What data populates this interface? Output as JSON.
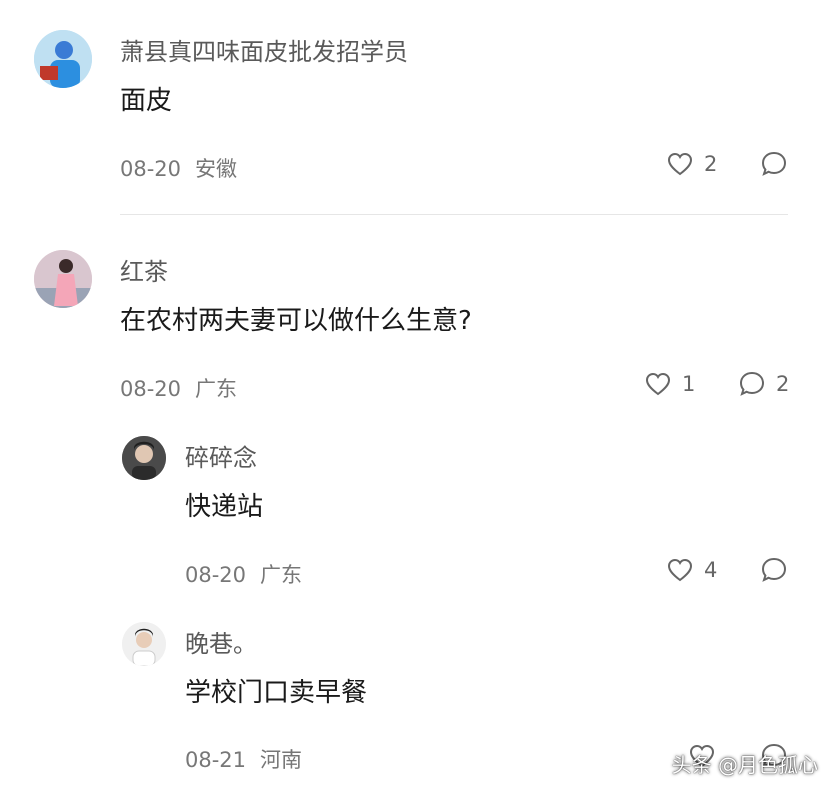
{
  "comments": [
    {
      "username": "萧县真四味面皮批发招学员",
      "text": "面皮",
      "date": "08-20",
      "location": "安徽",
      "likes": "2",
      "replies": ""
    },
    {
      "username": "红茶",
      "text": "在农村两夫妻可以做什么生意?",
      "date": "08-20",
      "location": "广东",
      "likes": "1",
      "replies": "2"
    }
  ],
  "replies": [
    {
      "username": "碎碎念",
      "text": "快递站",
      "date": "08-20",
      "location": "广东",
      "likes": "4",
      "replies": ""
    },
    {
      "username": "晚巷。",
      "text": "学校门口卖早餐",
      "date": "08-21",
      "location": "河南",
      "likes": "",
      "replies": ""
    }
  ],
  "watermark": "头条 @月色孤心",
  "icons": {
    "like": "heart-outline-icon",
    "reply": "speech-bubble-icon"
  }
}
